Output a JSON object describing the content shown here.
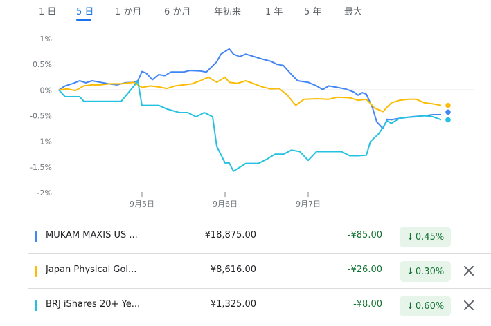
{
  "range_tabs": [
    {
      "label": "1 日",
      "active": false
    },
    {
      "label": "5 日",
      "active": true
    },
    {
      "label": "1 か月",
      "active": false
    },
    {
      "label": "6 か月",
      "active": false
    },
    {
      "label": "年初来",
      "active": false
    },
    {
      "label": "1 年",
      "active": false
    },
    {
      "label": "5 年",
      "active": false
    },
    {
      "label": "最大",
      "active": false
    }
  ],
  "colors": {
    "series1": "#4285f4",
    "series2": "#fbbc04",
    "series3": "#24c1e0",
    "negative": "#137333",
    "negative_bg": "#e6f4ea",
    "accent": "#1a73e8"
  },
  "chart_data": {
    "type": "line",
    "ylim": [
      -2,
      1
    ],
    "y_ticks": [
      "1%",
      "0.5%",
      "0%",
      "-0.5%",
      "-1%",
      "-1.5%",
      "-2%"
    ],
    "x_ticks": [
      "9月5日",
      "9月6日",
      "9月7日"
    ],
    "x_tick_positions": [
      0.2,
      0.4,
      0.6
    ],
    "x_range": [
      0,
      1
    ],
    "baseline": 0,
    "series": [
      {
        "color_key": "series1",
        "points": [
          [
            0,
            0
          ],
          [
            0.015,
            0.08
          ],
          [
            0.035,
            0.13
          ],
          [
            0.05,
            0.18
          ],
          [
            0.065,
            0.14
          ],
          [
            0.08,
            0.18
          ],
          [
            0.1,
            0.15
          ],
          [
            0.12,
            0.12
          ],
          [
            0.14,
            0.1
          ],
          [
            0.16,
            0.14
          ],
          [
            0.18,
            0.15
          ],
          [
            0.19,
            0.18
          ],
          [
            0.2,
            0.36
          ],
          [
            0.21,
            0.33
          ],
          [
            0.225,
            0.2
          ],
          [
            0.24,
            0.3
          ],
          [
            0.255,
            0.28
          ],
          [
            0.27,
            0.35
          ],
          [
            0.3,
            0.35
          ],
          [
            0.315,
            0.38
          ],
          [
            0.34,
            0.37
          ],
          [
            0.355,
            0.35
          ],
          [
            0.37,
            0.47
          ],
          [
            0.38,
            0.55
          ],
          [
            0.39,
            0.7
          ],
          [
            0.41,
            0.8
          ],
          [
            0.42,
            0.7
          ],
          [
            0.435,
            0.65
          ],
          [
            0.45,
            0.7
          ],
          [
            0.47,
            0.65
          ],
          [
            0.49,
            0.6
          ],
          [
            0.51,
            0.56
          ],
          [
            0.525,
            0.5
          ],
          [
            0.54,
            0.48
          ],
          [
            0.56,
            0.3
          ],
          [
            0.575,
            0.18
          ],
          [
            0.6,
            0.15
          ],
          [
            0.62,
            0.08
          ],
          [
            0.635,
            0.01
          ],
          [
            0.65,
            0.08
          ],
          [
            0.67,
            0.05
          ],
          [
            0.69,
            0.02
          ],
          [
            0.71,
            -0.04
          ],
          [
            0.72,
            -0.1
          ],
          [
            0.73,
            -0.05
          ],
          [
            0.74,
            -0.08
          ],
          [
            0.755,
            -0.35
          ],
          [
            0.765,
            -0.62
          ],
          [
            0.78,
            -0.75
          ],
          [
            0.79,
            -0.57
          ],
          [
            0.8,
            -0.58
          ],
          [
            0.82,
            -0.55
          ],
          [
            0.85,
            -0.52
          ],
          [
            0.88,
            -0.5
          ],
          [
            0.9,
            -0.48
          ],
          [
            0.92,
            -0.48
          ]
        ],
        "end_value": -0.43
      },
      {
        "color_key": "series2",
        "points": [
          [
            0,
            0
          ],
          [
            0.02,
            0.02
          ],
          [
            0.04,
            -0.01
          ],
          [
            0.06,
            0.08
          ],
          [
            0.08,
            0.1
          ],
          [
            0.1,
            0.1
          ],
          [
            0.12,
            0.12
          ],
          [
            0.15,
            0.12
          ],
          [
            0.18,
            0.15
          ],
          [
            0.2,
            0.05
          ],
          [
            0.22,
            0.08
          ],
          [
            0.24,
            0.06
          ],
          [
            0.26,
            0.03
          ],
          [
            0.28,
            0.08
          ],
          [
            0.3,
            0.1
          ],
          [
            0.32,
            0.12
          ],
          [
            0.34,
            0.18
          ],
          [
            0.36,
            0.25
          ],
          [
            0.38,
            0.15
          ],
          [
            0.4,
            0.25
          ],
          [
            0.41,
            0.15
          ],
          [
            0.43,
            0.13
          ],
          [
            0.45,
            0.18
          ],
          [
            0.47,
            0.12
          ],
          [
            0.49,
            0.06
          ],
          [
            0.51,
            0.02
          ],
          [
            0.53,
            0.03
          ],
          [
            0.55,
            -0.1
          ],
          [
            0.57,
            -0.3
          ],
          [
            0.59,
            -0.18
          ],
          [
            0.62,
            -0.17
          ],
          [
            0.65,
            -0.18
          ],
          [
            0.67,
            -0.14
          ],
          [
            0.7,
            -0.15
          ],
          [
            0.72,
            -0.2
          ],
          [
            0.74,
            -0.18
          ],
          [
            0.76,
            -0.35
          ],
          [
            0.78,
            -0.42
          ],
          [
            0.8,
            -0.25
          ],
          [
            0.82,
            -0.2
          ],
          [
            0.84,
            -0.18
          ],
          [
            0.86,
            -0.18
          ],
          [
            0.88,
            -0.25
          ],
          [
            0.9,
            -0.27
          ],
          [
            0.92,
            -0.3
          ]
        ],
        "end_value": -0.3
      },
      {
        "color_key": "series3",
        "points": [
          [
            0,
            0
          ],
          [
            0.015,
            -0.13
          ],
          [
            0.05,
            -0.13
          ],
          [
            0.06,
            -0.22
          ],
          [
            0.1,
            -0.22
          ],
          [
            0.15,
            -0.22
          ],
          [
            0.19,
            0.17
          ],
          [
            0.2,
            -0.3
          ],
          [
            0.24,
            -0.3
          ],
          [
            0.26,
            -0.37
          ],
          [
            0.29,
            -0.44
          ],
          [
            0.31,
            -0.44
          ],
          [
            0.33,
            -0.52
          ],
          [
            0.35,
            -0.44
          ],
          [
            0.37,
            -0.52
          ],
          [
            0.38,
            -1.1
          ],
          [
            0.4,
            -1.42
          ],
          [
            0.41,
            -1.42
          ],
          [
            0.42,
            -1.58
          ],
          [
            0.45,
            -1.43
          ],
          [
            0.48,
            -1.43
          ],
          [
            0.5,
            -1.35
          ],
          [
            0.52,
            -1.25
          ],
          [
            0.54,
            -1.25
          ],
          [
            0.56,
            -1.17
          ],
          [
            0.58,
            -1.2
          ],
          [
            0.6,
            -1.37
          ],
          [
            0.62,
            -1.2
          ],
          [
            0.64,
            -1.2
          ],
          [
            0.66,
            -1.2
          ],
          [
            0.68,
            -1.2
          ],
          [
            0.7,
            -1.28
          ],
          [
            0.72,
            -1.28
          ],
          [
            0.74,
            -1.27
          ],
          [
            0.75,
            -1.0
          ],
          [
            0.77,
            -0.85
          ],
          [
            0.79,
            -0.6
          ],
          [
            0.8,
            -0.65
          ],
          [
            0.82,
            -0.55
          ],
          [
            0.84,
            -0.53
          ],
          [
            0.86,
            -0.52
          ],
          [
            0.88,
            -0.5
          ],
          [
            0.9,
            -0.52
          ],
          [
            0.92,
            -0.58
          ]
        ],
        "end_value": -0.58
      }
    ]
  },
  "holdings": [
    {
      "name": "MUKAM MAXIS US ...",
      "price": "¥18,875.00",
      "change": "-¥85.00",
      "pct": "0.45%",
      "arrow": "↓",
      "color_key": "series1",
      "removable": false
    },
    {
      "name": "Japan Physical Gol...",
      "price": "¥8,616.00",
      "change": "-¥26.00",
      "pct": "0.30%",
      "arrow": "↓",
      "color_key": "series2",
      "removable": true
    },
    {
      "name": "BRJ iShares 20+ Ye...",
      "price": "¥1,325.00",
      "change": "-¥8.00",
      "pct": "0.60%",
      "arrow": "↓",
      "color_key": "series3",
      "removable": true
    }
  ]
}
